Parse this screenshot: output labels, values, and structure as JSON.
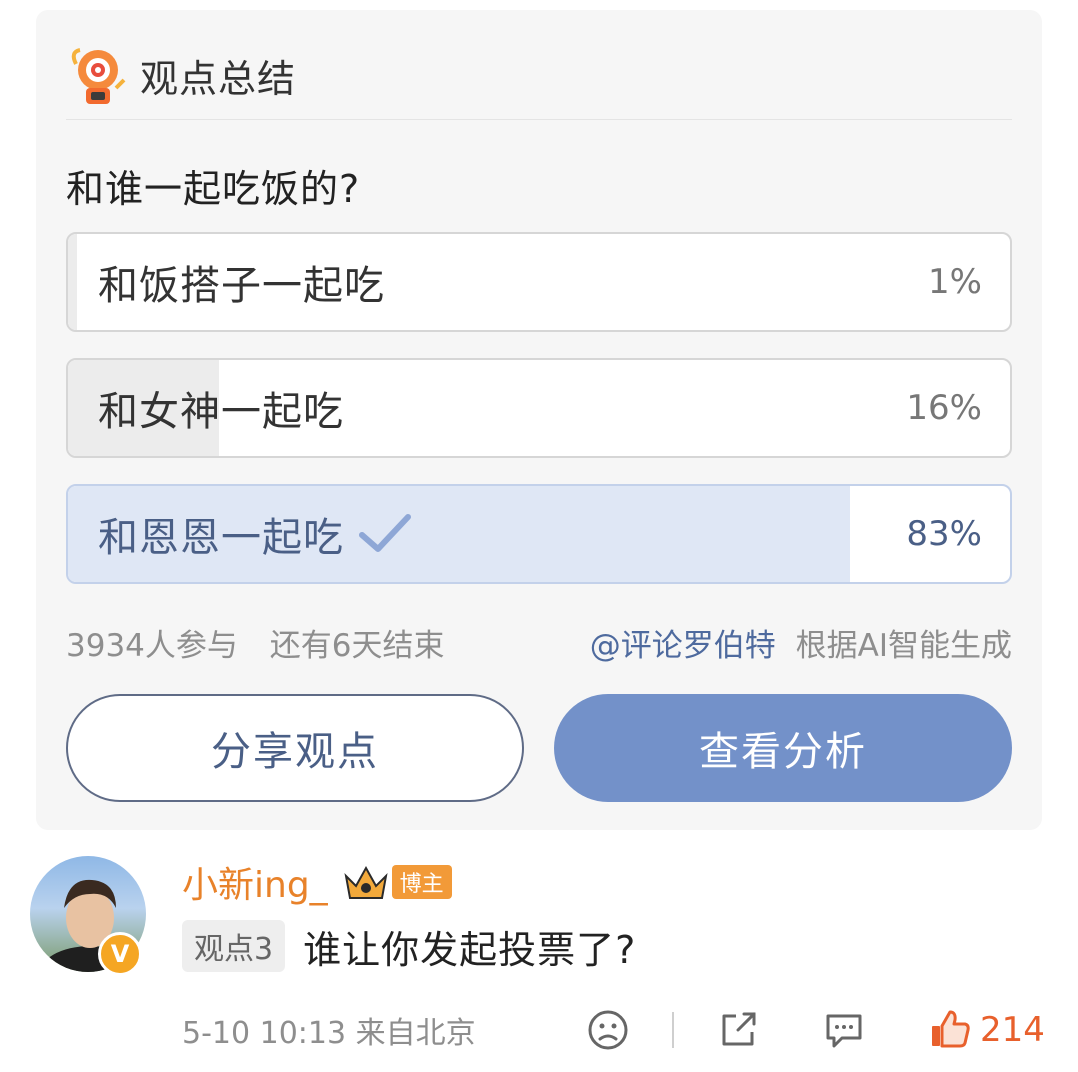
{
  "card": {
    "title": "观点总结",
    "question": "和谁一起吃饭的?",
    "options": [
      {
        "label": "和饭搭子一起吃",
        "percent_text": "1%",
        "percent": 1,
        "selected": false
      },
      {
        "label": "和女神一起吃",
        "percent_text": "16%",
        "percent": 16,
        "selected": false
      },
      {
        "label": "和恩恩一起吃",
        "percent_text": "83%",
        "percent": 83,
        "selected": true
      }
    ],
    "participants": "3934人参与",
    "remaining": "还有6天结束",
    "mention": "@评论罗伯特",
    "generated_by": "根据AI智能生成",
    "share_button": "分享观点",
    "analysis_button": "查看分析"
  },
  "comment": {
    "username": "小新ing_",
    "badge": "博主",
    "avatar_badge": "V",
    "opinion_tag": "观点3",
    "text": "谁让你发起投票了?",
    "time_location": "5-10 10:13 来自北京",
    "like_count": "214"
  },
  "colors": {
    "accent": "#7391c9",
    "selected_fill": "#dfe7f5",
    "username": "#e8822a",
    "like": "#e8602c"
  }
}
